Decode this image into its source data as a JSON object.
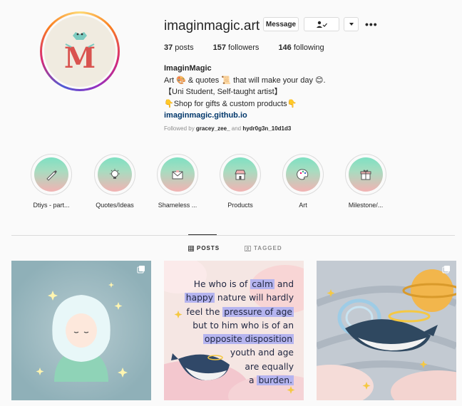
{
  "profile": {
    "username": "imaginmagic.art",
    "display_name": "ImaginMagic",
    "bio_line1": "Art 🎨 & quotes 📜 that will make your day 😊.",
    "bio_line2": "【Uni Student, Self-taught artist】",
    "bio_line3": "👇Shop for gifts & custom products👇",
    "website": "imaginmagic.github.io",
    "followed_by_prefix": "Followed by ",
    "followed_by_user1": "gracey_zee_",
    "followed_by_and": " and ",
    "followed_by_user2": "hydr0g3n_10d1d3"
  },
  "actions": {
    "message_label": "Message"
  },
  "stats": {
    "posts_num": "37",
    "posts_label": " posts",
    "followers_num": "157",
    "followers_label": " followers",
    "following_num": "146",
    "following_label": " following"
  },
  "highlights": [
    {
      "label": "Dtiys - part...",
      "icon": "pen-icon"
    },
    {
      "label": "Quotes/Ideas",
      "icon": "lightbulb-icon"
    },
    {
      "label": "Shameless ...",
      "icon": "envelope-icon"
    },
    {
      "label": "Products",
      "icon": "shop-icon"
    },
    {
      "label": "Art",
      "icon": "palette-icon"
    },
    {
      "label": "Milestone/...",
      "icon": "gift-icon"
    }
  ],
  "tabs": {
    "posts_label": "POSTS",
    "tagged_label": "TAGGED"
  },
  "posts": {
    "quote": {
      "l1a": "He who is of ",
      "l1b": "calm",
      "l1c": " and",
      "l2a": "happy",
      "l2b": " nature will hardly",
      "l3a": "feel the ",
      "l3b": "pressure of age",
      "l4": "but to him who is of an",
      "l5": "opposite disposition",
      "l6": "youth and age",
      "l7": "are equally",
      "l8a": "a ",
      "l8b": "burden."
    }
  },
  "colors": {
    "link": "#00376b",
    "highlight_gradient_top": "#7ee0c2",
    "highlight_gradient_bottom": "#f2b3b3",
    "quote_highlight": "#b5b4ef"
  }
}
